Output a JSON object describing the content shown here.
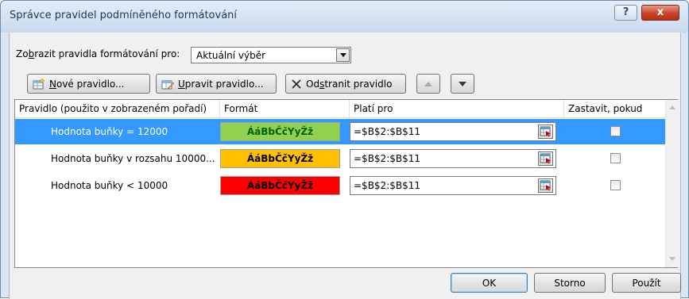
{
  "window": {
    "title": "Správce pravidel podmíněného formátování",
    "help_label": "?",
    "close_label": "x"
  },
  "filter": {
    "label_prefix": "Zo",
    "label_accel": "b",
    "label_suffix": "razit pravidla formátování pro:",
    "selected_value": "Aktuální výběr"
  },
  "toolbar": {
    "new_rule_accel": "N",
    "new_rule_rest": "ové pravidlo...",
    "edit_rule_accel": "U",
    "edit_rule_rest": "pravit pravidlo...",
    "delete_rule_pre": "Od",
    "delete_rule_accel": "s",
    "delete_rule_rest": "tranit pravidlo"
  },
  "table": {
    "columns": [
      "Pravidlo (použito v zobrazeném pořadí)",
      "Formát",
      "Platí pro",
      "Zastavit, pokud platí"
    ],
    "rows": [
      {
        "rule": "Hodnota buňky = 12000",
        "format_sample": "ÁáBbČčYyŽž",
        "format_bg": "#92d050",
        "format_fg": "#006100",
        "applies_to": "=$B$2:$B$11",
        "stop_if_true": false,
        "selected": true
      },
      {
        "rule": "Hodnota buňky v rozsahu 10000...",
        "format_sample": "ÁáBbČčYyŽž",
        "format_bg": "#ffc000",
        "format_fg": "#000000",
        "applies_to": "=$B$2:$B$11",
        "stop_if_true": false,
        "selected": false
      },
      {
        "rule": "Hodnota buňky < 10000",
        "format_sample": "ÁáBbČčYyŽž",
        "format_bg": "#ff0000",
        "format_fg": "#000000",
        "applies_to": "=$B$2:$B$11",
        "stop_if_true": false,
        "selected": false
      }
    ]
  },
  "footer": {
    "ok_label": "OK",
    "cancel_label": "Storno",
    "apply_label": "Použít"
  },
  "colors": {
    "selection": "#3399ff"
  }
}
